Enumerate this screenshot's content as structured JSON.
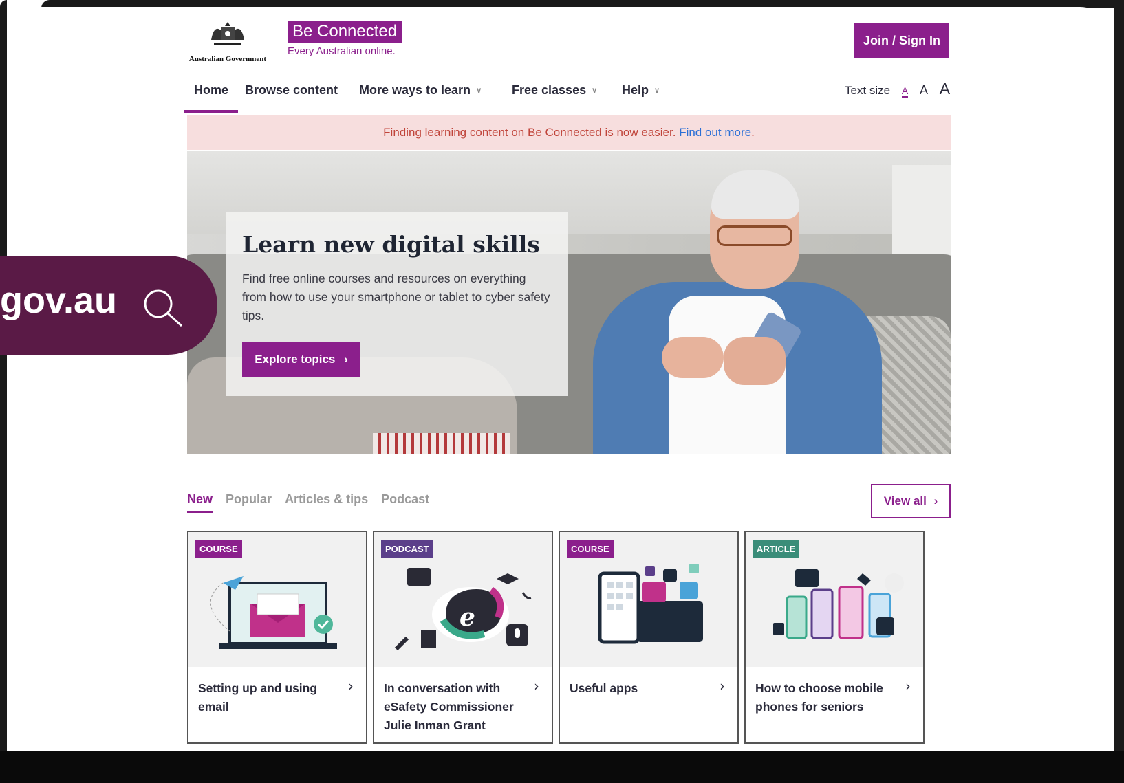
{
  "header": {
    "gov_text": "Australian Government",
    "brand_name": "Be Connected",
    "brand_tagline": "Every Australian online.",
    "join_label": "Join / Sign In"
  },
  "nav": {
    "items": [
      {
        "label": "Home",
        "active": true
      },
      {
        "label": "Browse content"
      },
      {
        "label": "More ways to learn",
        "dropdown": true
      },
      {
        "label": "Free classes",
        "dropdown": true
      },
      {
        "label": "Help",
        "dropdown": true
      }
    ],
    "text_size_label": "Text size",
    "text_size_options": [
      "A",
      "A",
      "A"
    ]
  },
  "notice": {
    "text": "Finding learning content on Be Connected is now easier.",
    "link": "Find out more",
    "suffix": "."
  },
  "hero": {
    "title": "Learn new digital skills",
    "subtitle": "Find free online courses and resources on everything from how to use your smartphone or tablet to cyber safety tips.",
    "button_label": "Explore topics"
  },
  "search_overlay": {
    "text": "gov.au"
  },
  "tabs": {
    "items": [
      "New",
      "Popular",
      "Articles & tips",
      "Podcast"
    ],
    "active_index": 0,
    "view_all_label": "View all"
  },
  "cards": [
    {
      "type": "COURSE",
      "title": "Setting up and using email",
      "icon": "email-laptop-icon"
    },
    {
      "type": "PODCAST",
      "title": "In conversation with eSafety Commissioner Julie Inman Grant",
      "icon": "esafety-podcast-icon"
    },
    {
      "type": "COURSE",
      "title": "Useful apps",
      "icon": "apps-devices-icon"
    },
    {
      "type": "ARTICLE",
      "title": "How to choose mobile phones for seniors",
      "icon": "mobile-phones-icon"
    }
  ],
  "colors": {
    "brand": "#8b1f8c",
    "notice_bg": "#f7dede",
    "notice_text": "#c0443a",
    "link": "#2b6fd6",
    "search_pill": "#5a1a46"
  }
}
